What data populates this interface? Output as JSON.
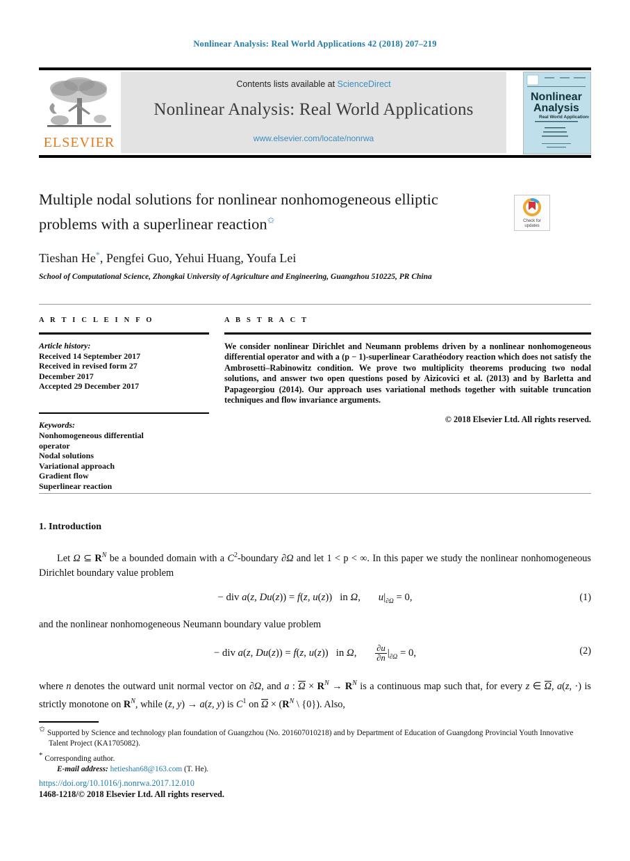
{
  "running_head": "Nonlinear Analysis: Real World Applications 42 (2018) 207–219",
  "masthead": {
    "contents_prefix": "Contents lists available at",
    "sciencedirect": "ScienceDirect",
    "journal_name": "Nonlinear Analysis: Real World Applications",
    "journal_url": "www.elsevier.com/locate/nonrwa",
    "publisher_logo_text": "ELSEVIER",
    "cover": {
      "title_line1": "Nonlinear",
      "title_line2": "Analysis",
      "subtitle": "Real World Applications"
    }
  },
  "article": {
    "title_line1": "Multiple nodal solutions for nonlinear nonhomogeneous elliptic",
    "title_line2": "problems with a superlinear reaction",
    "title_footnote_mark": "✩",
    "authors": "Tieshan He",
    "authors_rest": ", Pengfei Guo, Yehui Huang, Youfa Lei",
    "corresponding_mark": "*",
    "affiliation_line1": "School of Computational Science, Zhongkai University of Agriculture and Engineering, Guangzhou",
    "affiliation_line2": "510225, PR China"
  },
  "crossmark": {
    "label_line1": "Check for",
    "label_line2": "updates"
  },
  "info": {
    "heading": "A R T I C L E   I N F O",
    "history_title": "Article history:",
    "history_lines": [
      "Received 14 September 2017",
      "Received in revised form 27",
      "December 2017",
      "Accepted 29 December 2017"
    ],
    "keywords_title": "Keywords:",
    "keywords": [
      "Nonhomogeneous differential",
      "operator",
      "Nodal solutions",
      "Variational approach",
      "Gradient flow",
      "Superlinear reaction"
    ]
  },
  "abstract": {
    "heading": "A B S T R A C T",
    "text": "We consider nonlinear Dirichlet and Neumann problems driven by a nonlinear nonhomogeneous differential operator and with a (p − 1)-superlinear Carathéodory reaction which does not satisfy the Ambrosetti–Rabinowitz condition. We prove two multiplicity theorems producing two nodal solutions, and answer two open questions posed by Aizicovici et al. (2013) and by Barletta and Papageorgiou (2014). Our approach uses variational methods together with suitable truncation techniques and flow invariance arguments.",
    "copyright": "© 2018 Elsevier Ltd. All rights reserved."
  },
  "body": {
    "section_heading": "1. Introduction",
    "para1_a": "Let ",
    "para1_b": " be a bounded domain with a ",
    "para1_c": "-boundary ",
    "para1_d": " and let 1 < p < ∞. In this paper we study the nonlinear nonhomogeneous Dirichlet boundary value problem",
    "eq1": "− div a(z, Du(z)) = f(z, u(z))   in Ω,      u|∂Ω = 0,",
    "eq1_num": "(1)",
    "para2": "and the nonlinear nonhomogeneous Neumann boundary value problem",
    "eq2_num": "(2)",
    "para3": "where n denotes the outward unit normal vector on ∂Ω, and a : Ω × R^N → R^N is a continuous map such that, for every z ∈ Ω, a(z, ·) is strictly monotone on R^N, while (z, y) → a(z, y) is C¹ on Ω × (R^N \\ {0}). Also,"
  },
  "footnotes": {
    "mark1": "✩",
    "note1": "Supported by Science and technology plan foundation of Guangzhou (No. 201607010218) and by Department of Education of Guangdong Provincial Youth Innovative Talent Project (KA1705082).",
    "mark2": "*",
    "note2": "Corresponding author.",
    "email_label": "E-mail address:",
    "email": "hetieshan68@163.com",
    "email_suffix": "(T. He)."
  },
  "footer": {
    "doi": "https://doi.org/10.1016/j.nonrwa.2017.12.010",
    "issn_line": "1468-1218/© 2018 Elsevier Ltd. All rights reserved."
  },
  "colors": {
    "accent_blue": "#1f7ca8",
    "link_blue": "#3a8ec0",
    "elsevier_orange": "#e8791b",
    "masthead_gray": "#e3e3e3",
    "cover_blue": "#bfe0ea"
  }
}
